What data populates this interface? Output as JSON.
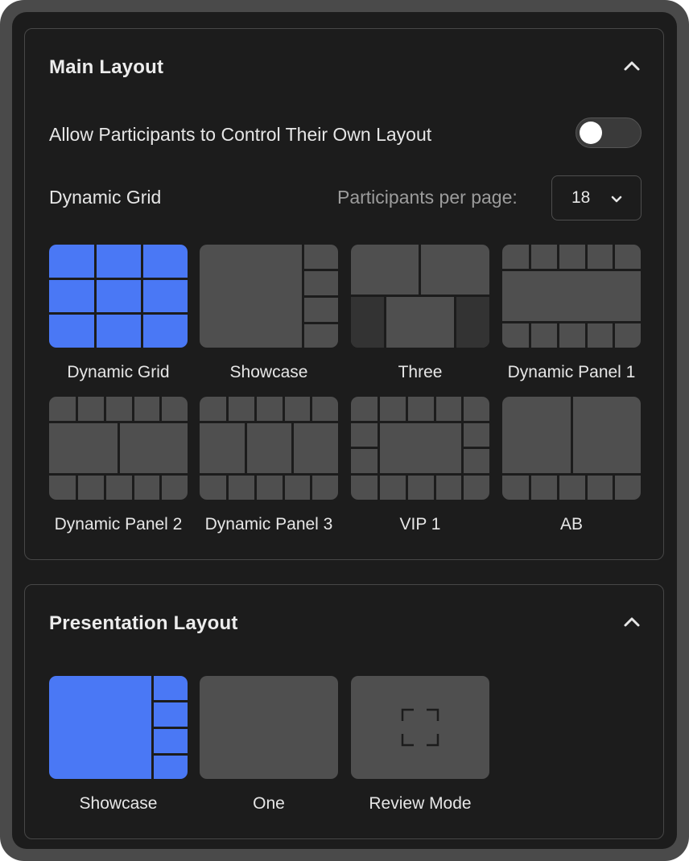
{
  "main_layout": {
    "title": "Main Layout",
    "allow_control_label": "Allow Participants to Control Their Own Layout",
    "allow_control_enabled": false,
    "dynamic_grid_label": "Dynamic Grid",
    "participants_per_page_label": "Participants per page:",
    "participants_per_page_value": "18",
    "layouts": [
      {
        "label": "Dynamic Grid",
        "selected": true
      },
      {
        "label": "Showcase",
        "selected": false
      },
      {
        "label": "Three",
        "selected": false
      },
      {
        "label": "Dynamic Panel 1",
        "selected": false
      },
      {
        "label": "Dynamic Panel 2",
        "selected": false
      },
      {
        "label": "Dynamic Panel 3",
        "selected": false
      },
      {
        "label": "VIP 1",
        "selected": false
      },
      {
        "label": "AB",
        "selected": false
      }
    ]
  },
  "presentation_layout": {
    "title": "Presentation Layout",
    "layouts": [
      {
        "label": "Showcase",
        "selected": true
      },
      {
        "label": "One",
        "selected": false
      },
      {
        "label": "Review Mode",
        "selected": false
      }
    ]
  },
  "colors": {
    "selected": "#4a78f5",
    "tile": "#4f4f4f",
    "tile_dark": "#333333",
    "background": "#1c1c1c"
  }
}
